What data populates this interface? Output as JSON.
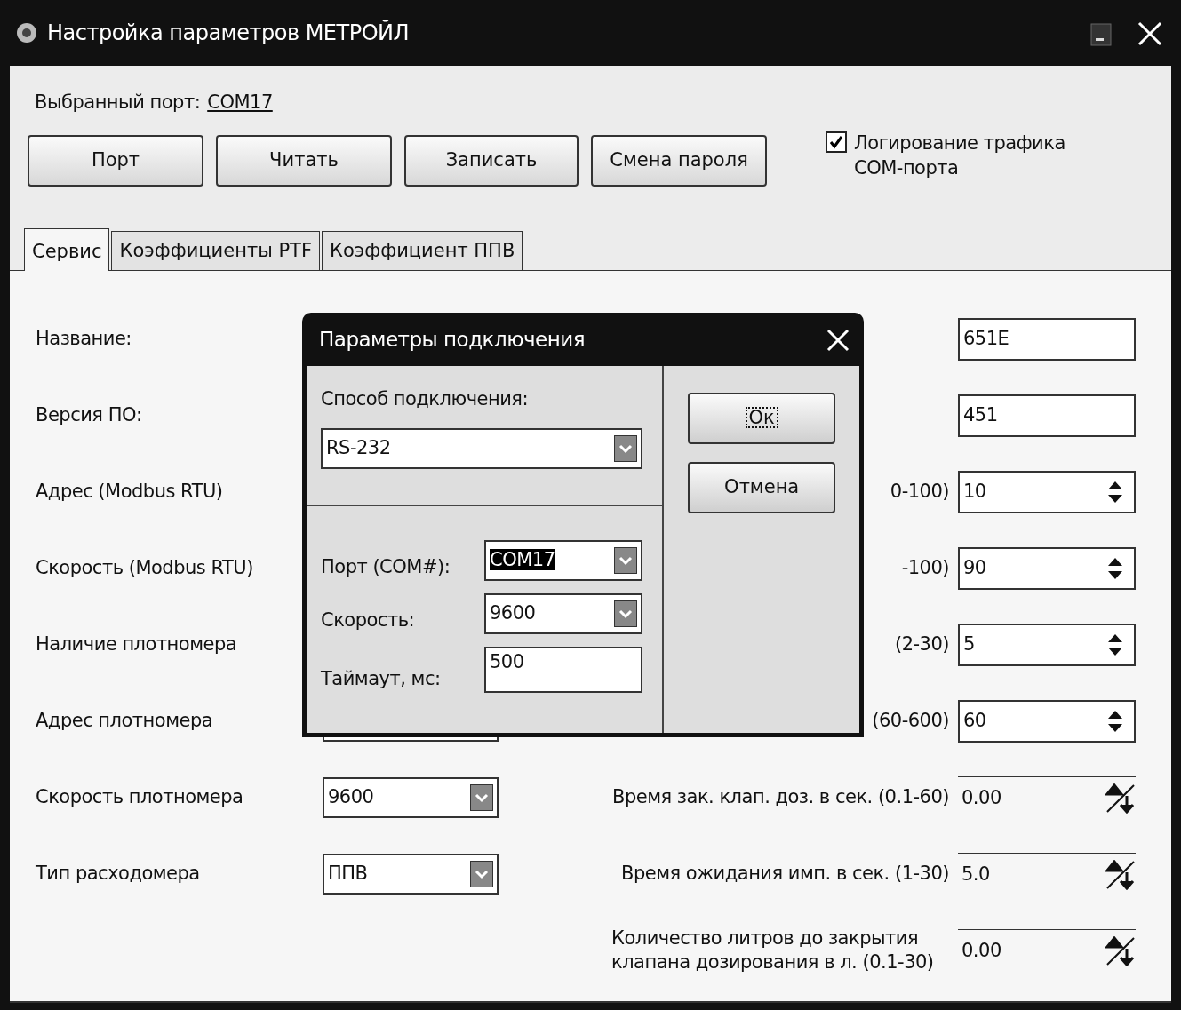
{
  "window": {
    "title": "Настройка параметров МЕТРОЙЛ"
  },
  "selected_port": {
    "label": "Выбранный порт:",
    "value": "COM17"
  },
  "toolbar": {
    "buttons": [
      "Порт",
      "Читать",
      "Записать",
      "Смена пароля"
    ],
    "logging": {
      "label": "Логирование трафика COM-порта",
      "checked": true
    }
  },
  "tabs": [
    {
      "label": "Сервис",
      "selected": true
    },
    {
      "label": "Коэффициенты PTF",
      "selected": false
    },
    {
      "label": "Коэффициент ППВ",
      "selected": false
    }
  ],
  "form": {
    "rows": [
      {
        "label": "Название:",
        "field": {
          "kind": "text",
          "value": "651E"
        }
      },
      {
        "label": "Версия ПО:",
        "field": {
          "kind": "text",
          "value": "451"
        }
      },
      {
        "label": "Адрес (Modbus RTU)",
        "right_label": "0-100)",
        "field": {
          "kind": "spin",
          "value": "10"
        }
      },
      {
        "label": "Скорость (Modbus RTU)",
        "right_label": "-100)",
        "field": {
          "kind": "spin",
          "value": "90"
        }
      },
      {
        "label": "Наличие плотномера",
        "right_label": "(2-30)",
        "field": {
          "kind": "spin",
          "value": "5"
        }
      },
      {
        "label": "Адрес плотномера",
        "combo": {
          "kind": "combo"
        },
        "right_label": "(60-600)",
        "field": {
          "kind": "spin",
          "value": "60"
        }
      },
      {
        "label": "Скорость плотномера",
        "combo": {
          "kind": "combo",
          "value": "9600"
        },
        "right_label": "Время зак. клап. доз. в сек. (0.1-60)",
        "field": {
          "kind": "numeric",
          "value": "0.00"
        }
      },
      {
        "label": "Тип расходомера",
        "combo": {
          "kind": "combo",
          "value": "ППВ"
        },
        "right_label": "Время ожидания имп. в сек. (1-30)",
        "field": {
          "kind": "numeric",
          "value": "5.0"
        }
      },
      {
        "right_label": "Количество литров до закрытия клапана дозирования в л. (0.1-30)",
        "field": {
          "kind": "numeric",
          "value": "0.00"
        }
      }
    ]
  },
  "dialog": {
    "title": "Параметры подключения",
    "method": {
      "label": "Способ подключения:",
      "value": "RS-232"
    },
    "fields": [
      {
        "label": "Порт (COM#):",
        "kind": "combo",
        "value": "COM17",
        "highlighted": true
      },
      {
        "label": "Скорость:",
        "kind": "combo",
        "value": "9600",
        "highlighted": false
      },
      {
        "label": "Таймаут, мс:",
        "kind": "text",
        "value": "500",
        "highlighted": false
      }
    ],
    "buttons": [
      {
        "label": "Ок",
        "focused": true
      },
      {
        "label": "Отмена",
        "focused": false
      }
    ]
  }
}
